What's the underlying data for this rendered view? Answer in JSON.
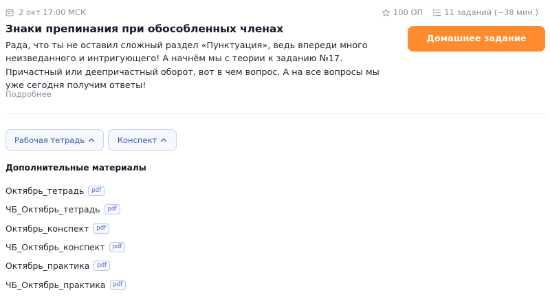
{
  "lesson": {
    "date": "2 окт 17:00 МСК",
    "points": "100 ОП",
    "tasks": "11 заданий (~38 мин.)",
    "title": "Знаки препинания при обособленных членах",
    "description": "Рада, что ты не оставил сложный раздел «Пунктуация», ведь впереди много неизведанного и интригующего! А начнём мы с теории к заданию №17. Причастный или деепричастный оборот, вот в чем вопрос. А на все вопросы мы уже сегодня получим ответы!",
    "more_link": "Подробнее",
    "homework_button": "Домашнее задание"
  },
  "toggles": {
    "workbook": "Рабочая тетрадь",
    "notes": "Конспект"
  },
  "materials": {
    "heading": "Дополнительные материалы",
    "items": [
      {
        "name": "Октябрь_тетрадь",
        "badge": "pdf"
      },
      {
        "name": "ЧБ_Октябрь_тетрадь",
        "badge": "pdf"
      },
      {
        "name": "Октябрь_конспект",
        "badge": "pdf"
      },
      {
        "name": "ЧБ_Октябрь_конспект",
        "badge": "pdf"
      },
      {
        "name": "Октябрь_практика",
        "badge": "pdf"
      },
      {
        "name": "ЧБ_Октябрь_практика",
        "badge": "pdf"
      }
    ]
  },
  "colors": {
    "accent_orange": "#ff8b2e",
    "link_blue": "#3b5cab",
    "muted_text": "#8a8f9c"
  },
  "icons": {
    "date": "calendar-icon",
    "points": "star-icon",
    "tasks": "task-list-icon",
    "toggle": "chevron-up-icon"
  }
}
